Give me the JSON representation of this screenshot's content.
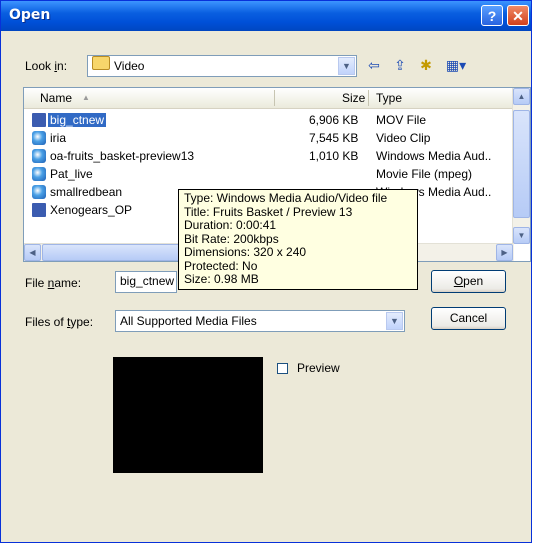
{
  "dialog": {
    "title": "Open",
    "help_glyph": "?",
    "close_glyph": "✕"
  },
  "look_in": {
    "label_pre": "Look ",
    "label_accel": "i",
    "label_post": "n:",
    "value": "Video",
    "icon": "folder-icon"
  },
  "toolbar": {
    "back_glyph": "⇦",
    "up_glyph": "⇪",
    "new_folder_glyph": "✱",
    "views_glyph": "▦▾"
  },
  "list": {
    "columns": {
      "name": "Name",
      "size": "Size",
      "type": "Type"
    },
    "sort_glyph": "▲",
    "rows": [
      {
        "name": "big_ctnew",
        "size": "6,906 KB",
        "type": "MOV File",
        "icon": "mov-file-icon",
        "selected": true
      },
      {
        "name": "iria",
        "size": "7,545 KB",
        "type": "Video Clip",
        "icon": "media-file-icon"
      },
      {
        "name": "oa-fruits_basket-preview13",
        "size": "1,010 KB",
        "type": "Windows Media Aud..",
        "icon": "media-file-icon"
      },
      {
        "name": "Pat_live",
        "size": "",
        "type": "Movie File (mpeg)",
        "icon": "media-file-icon"
      },
      {
        "name": "smallredbean",
        "size": "",
        "type": "Windows Media Aud..",
        "icon": "media-file-icon"
      },
      {
        "name": "Xenogears_OP",
        "size": "",
        "type": "",
        "icon": "mov-file-icon"
      }
    ]
  },
  "tooltip": {
    "lines": [
      "Type: Windows Media Audio/Video file",
      "Title: Fruits Basket / Preview 13",
      "Duration: 0:00:41",
      "Bit Rate: 200kbps",
      "Dimensions: 320 x 240",
      "Protected: No",
      "Size: 0.98 MB"
    ]
  },
  "file_name": {
    "label_pre": "File ",
    "label_accel": "n",
    "label_post": "ame:",
    "value": "big_ctnew"
  },
  "file_type": {
    "label_pre": "Files of ",
    "label_accel": "t",
    "label_post": "ype:",
    "value": "All Supported Media Files"
  },
  "buttons": {
    "open_accel": "O",
    "open_rest": "pen",
    "cancel": "Cancel"
  },
  "preview": {
    "label": "Preview",
    "checked": false
  }
}
